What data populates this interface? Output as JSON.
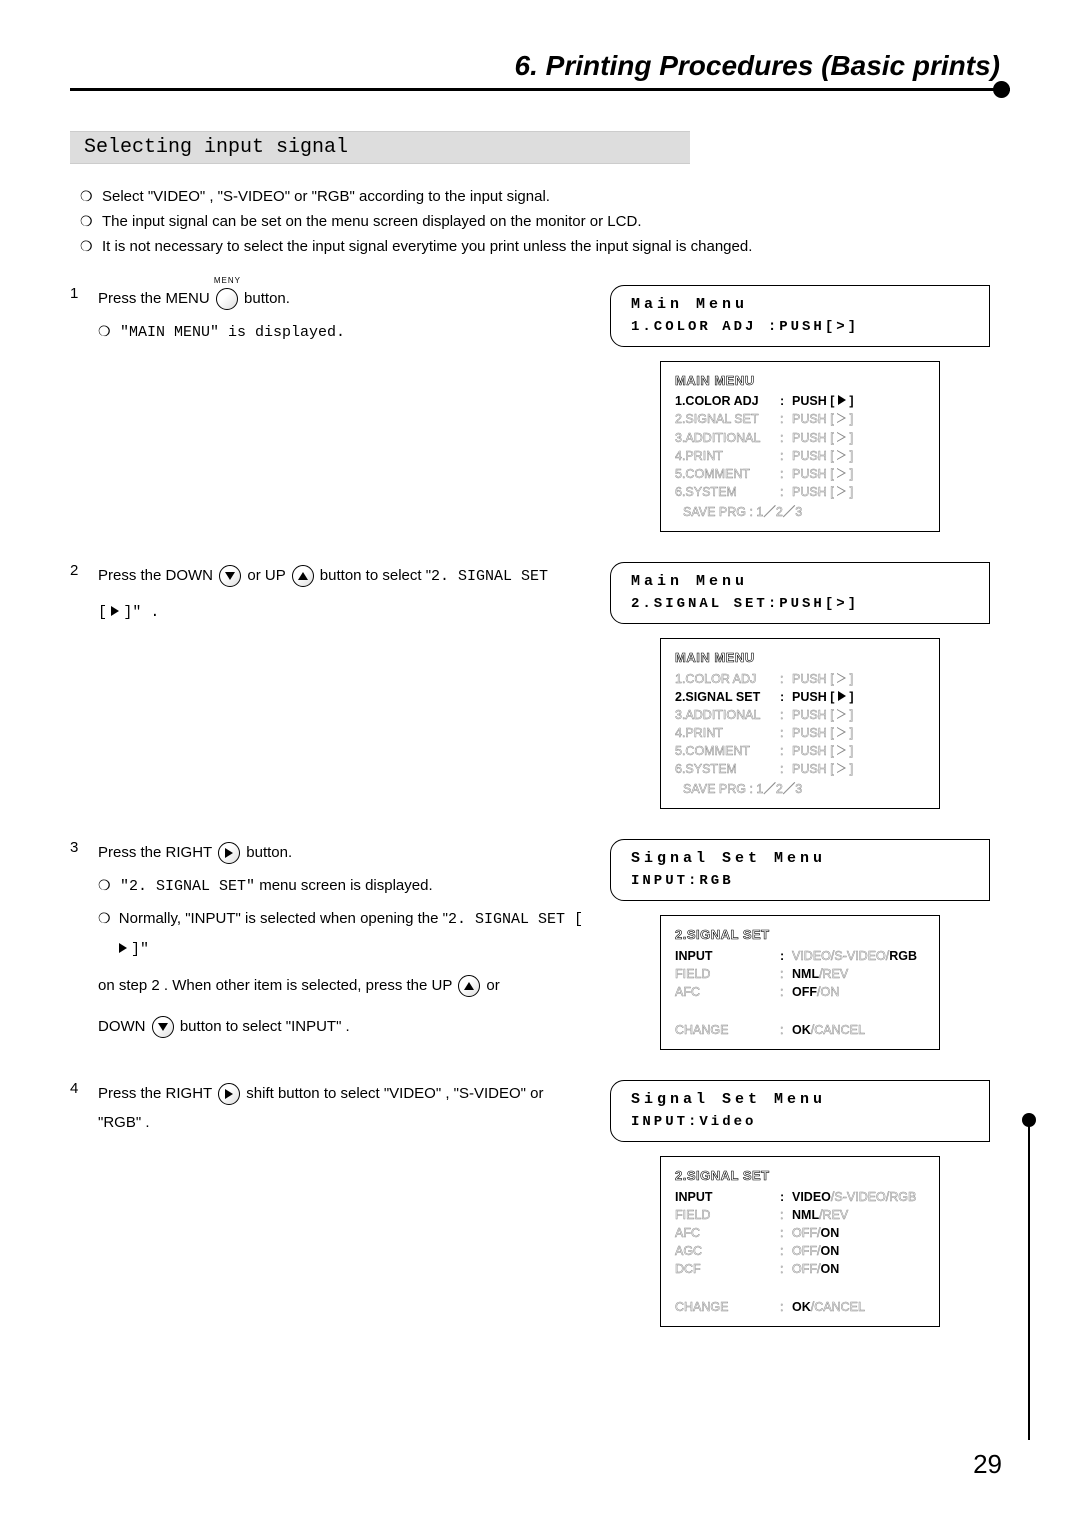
{
  "chapter_title": "6. Printing Procedures (Basic prints)",
  "section_heading": "Selecting input signal",
  "intro_bullets": [
    "Select \"VIDEO\" , \"S-VIDEO\"  or \"RGB\" according to the input signal.",
    "The input signal can be set on the menu screen displayed on the monitor or LCD.",
    "It is not necessary to select the input signal everytime you print unless the input signal is changed."
  ],
  "steps": {
    "s1": {
      "num": "1",
      "pre": "Press the MENU",
      "btn_top": "MENY",
      "post": "button.",
      "sub1": "\"MAIN MENU\" is displayed.",
      "lcd_l1": "Main Menu",
      "lcd_l2": "1.COLOR ADJ :PUSH[>]",
      "osd": {
        "title": "MAIN MENU",
        "rows": [
          {
            "lbl": "1.COLOR ADJ",
            "val": "PUSH [",
            "icon": "f",
            "hl": true
          },
          {
            "lbl": "2.SIGNAL SET",
            "val": "PUSH [",
            "icon": "o"
          },
          {
            "lbl": "3.ADDITIONAL",
            "val": "PUSH [",
            "icon": "o"
          },
          {
            "lbl": "4.PRINT",
            "val": "PUSH [",
            "icon": "o"
          },
          {
            "lbl": "5.COMMENT",
            "val": "PUSH [",
            "icon": "o"
          },
          {
            "lbl": "6.SYSTEM",
            "val": "PUSH [",
            "icon": "o"
          }
        ],
        "save": "SAVE PRG : 1／2／3"
      }
    },
    "s2": {
      "num": "2",
      "t1": "Press the DOWN",
      "t2": "or UP",
      "t3": "button to select \"",
      "mono1": "2. SIGNAL SET",
      "t4": "[",
      "t5": "]\" .",
      "lcd_l1": "Main Menu",
      "lcd_l2": "2.SIGNAL SET:PUSH[>]",
      "osd": {
        "title": "MAIN MENU",
        "rows": [
          {
            "lbl": "1.COLOR ADJ",
            "val": "PUSH [",
            "icon": "o"
          },
          {
            "lbl": "2.SIGNAL SET",
            "val": "PUSH [",
            "icon": "f",
            "hl": true
          },
          {
            "lbl": "3.ADDITIONAL",
            "val": "PUSH [",
            "icon": "o"
          },
          {
            "lbl": "4.PRINT",
            "val": "PUSH [",
            "icon": "o"
          },
          {
            "lbl": "5.COMMENT",
            "val": "PUSH [",
            "icon": "o"
          },
          {
            "lbl": "6.SYSTEM",
            "val": "PUSH [",
            "icon": "o"
          }
        ],
        "save": "SAVE PRG : 1／2／3"
      }
    },
    "s3": {
      "num": "3",
      "t1": "Press the RIGHT",
      "t2": "button.",
      "sub1": "\"2. SIGNAL SET\" menu screen is displayed.",
      "sub2a": "Normally, \"INPUT\" is selected when opening the \"",
      "sub2mono": "2. SIGNAL SET [",
      "sub2b": "]\"",
      "sub3a": "on step 2 .  When other item is selected, press the UP",
      "sub3b": "or",
      "sub4a": "DOWN",
      "sub4b": "button  to select \"INPUT\" .",
      "lcd_l1": "Signal Set Menu",
      "lcd_l2": "INPUT:RGB",
      "osd": {
        "title": "2.SIGNAL SET",
        "rows": [
          {
            "lbl": "INPUT",
            "valparts": [
              {
                "t": "VIDEO/",
                "o": true
              },
              {
                "t": "S-VIDEO/",
                "o": true
              },
              {
                "t": "RGB",
                "b": true
              }
            ],
            "hl": true
          },
          {
            "lbl": "FIELD",
            "valparts": [
              {
                "t": "NML",
                "b": true
              },
              {
                "t": "/REV",
                "o": true
              }
            ]
          },
          {
            "lbl": "AFC",
            "valparts": [
              {
                "t": "OFF",
                "b": true
              },
              {
                "t": "/ON",
                "o": true
              }
            ]
          }
        ],
        "change_l": "CHANGE",
        "change_r": [
          {
            "t": "OK",
            "b": true
          },
          {
            "t": "/CANCEL",
            "o": true
          }
        ]
      }
    },
    "s4": {
      "num": "4",
      "t1": "Press the RIGHT",
      "t2": "shift button to select \"VIDEO\" , \"S-VIDEO\" or \"RGB\" .",
      "lcd_l1": "Signal Set Menu",
      "lcd_l2": "INPUT:Video",
      "osd": {
        "title": "2.SIGNAL SET",
        "rows": [
          {
            "lbl": "INPUT",
            "valparts": [
              {
                "t": "VIDEO",
                "b": true
              },
              {
                "t": "/S-VIDEO/",
                "o": true
              },
              {
                "t": "RGB",
                "o": true
              }
            ],
            "hl": true
          },
          {
            "lbl": "FIELD",
            "valparts": [
              {
                "t": "NML",
                "b": true
              },
              {
                "t": "/REV",
                "o": true
              }
            ]
          },
          {
            "lbl": "AFC",
            "valparts": [
              {
                "t": "OFF/",
                "o": true
              },
              {
                "t": "ON",
                "b": true
              }
            ]
          },
          {
            "lbl": "AGC",
            "valparts": [
              {
                "t": "OFF/",
                "o": true
              },
              {
                "t": "ON",
                "b": true
              }
            ]
          },
          {
            "lbl": "DCF",
            "valparts": [
              {
                "t": "OFF/",
                "o": true
              },
              {
                "t": "ON",
                "b": true
              }
            ]
          }
        ],
        "change_l": "CHANGE",
        "change_r": [
          {
            "t": "OK",
            "b": true
          },
          {
            "t": "/CANCEL",
            "o": true
          }
        ]
      }
    }
  },
  "page_number": "29"
}
